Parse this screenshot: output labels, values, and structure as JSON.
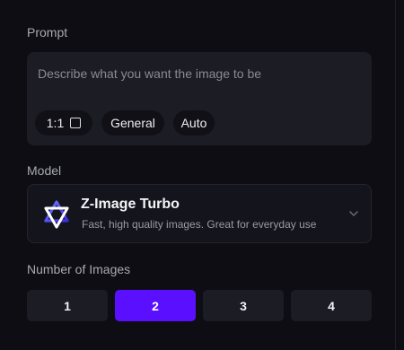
{
  "prompt": {
    "label": "Prompt",
    "placeholder": "Describe what you want the image to be",
    "value": "",
    "chips": {
      "ratio": "1:1",
      "style": "General",
      "mode": "Auto"
    }
  },
  "model": {
    "label": "Model",
    "name": "Z-Image Turbo",
    "description": "Fast, high quality images. Great for everyday use",
    "logo_icon": "model-logo-icon"
  },
  "num_images": {
    "label": "Number of Images",
    "options": [
      "1",
      "2",
      "3",
      "4"
    ],
    "selected": "2"
  },
  "colors": {
    "background": "#0d0d13",
    "surface": "#1c1c24",
    "accent": "#5a10ff"
  }
}
